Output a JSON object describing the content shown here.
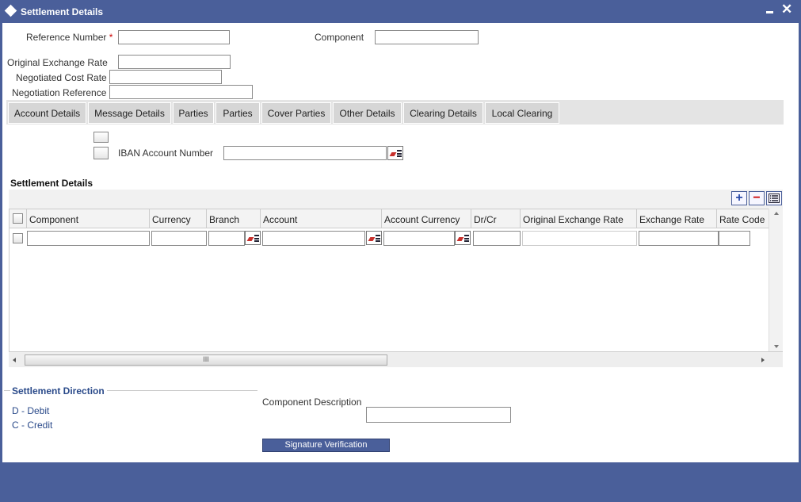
{
  "window": {
    "title": "Settlement Details",
    "minimize_icon": "minimize-icon",
    "close_icon": "close-icon",
    "close_glyph": "✕"
  },
  "form": {
    "reference_number_label": "Reference Number",
    "required_mark": "*",
    "component_label": "Component",
    "original_exchange_rate_label": "Original Exchange Rate",
    "negotiated_cost_rate_label": "Negotiated Cost Rate",
    "negotiation_reference_label": "Negotiation Reference",
    "reference_number_value": "",
    "component_value": "",
    "original_exchange_rate_value": "",
    "negotiated_cost_rate_value": "",
    "negotiation_reference_value": ""
  },
  "tabs": [
    {
      "label": "Account Details"
    },
    {
      "label": "Message Details"
    },
    {
      "label": "Parties"
    },
    {
      "label": "Parties"
    },
    {
      "label": "Cover Parties"
    },
    {
      "label": "Other Details"
    },
    {
      "label": "Clearing Details"
    },
    {
      "label": "Local Clearing"
    }
  ],
  "account_tab": {
    "iban_label": "IBAN Account Number",
    "iban_value": ""
  },
  "settlement_grid": {
    "title": "Settlement Details",
    "add_glyph": "+",
    "remove_glyph": "−",
    "columns": [
      "Component",
      "Currency",
      "Branch",
      "Account",
      "Account Currency",
      "Dr/Cr",
      "Original Exchange Rate",
      "Exchange Rate",
      "Rate Code"
    ],
    "scroll_thumb_label": "III"
  },
  "settlement_direction": {
    "title": "Settlement Direction",
    "debit": "D - Debit",
    "credit": "C - Credit"
  },
  "component_description": {
    "label": "Component Description",
    "value": ""
  },
  "buttons": {
    "signature_verification": "Signature Verification"
  },
  "colors": {
    "chrome": "#4a5f9a",
    "tab": "#d6d6d6",
    "required": "#cc0000"
  }
}
